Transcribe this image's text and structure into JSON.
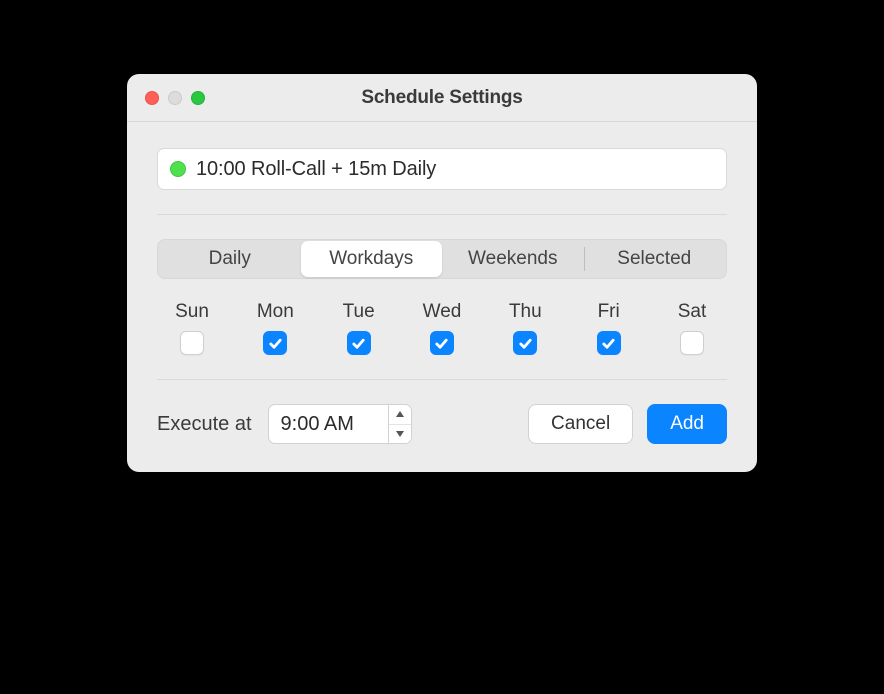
{
  "window": {
    "title": "Schedule Settings"
  },
  "schedule": {
    "status_color": "#4fe04f",
    "name": "10:00 Roll-Call + 15m Daily"
  },
  "segments": {
    "daily": "Daily",
    "workdays": "Workdays",
    "weekends": "Weekends",
    "selected": "Selected",
    "active": "workdays"
  },
  "days": [
    {
      "label": "Sun",
      "checked": false
    },
    {
      "label": "Mon",
      "checked": true
    },
    {
      "label": "Tue",
      "checked": true
    },
    {
      "label": "Wed",
      "checked": true
    },
    {
      "label": "Thu",
      "checked": true
    },
    {
      "label": "Fri",
      "checked": true
    },
    {
      "label": "Sat",
      "checked": false
    }
  ],
  "execute": {
    "label": "Execute at",
    "time": "9:00 AM"
  },
  "buttons": {
    "cancel": "Cancel",
    "add": "Add"
  }
}
